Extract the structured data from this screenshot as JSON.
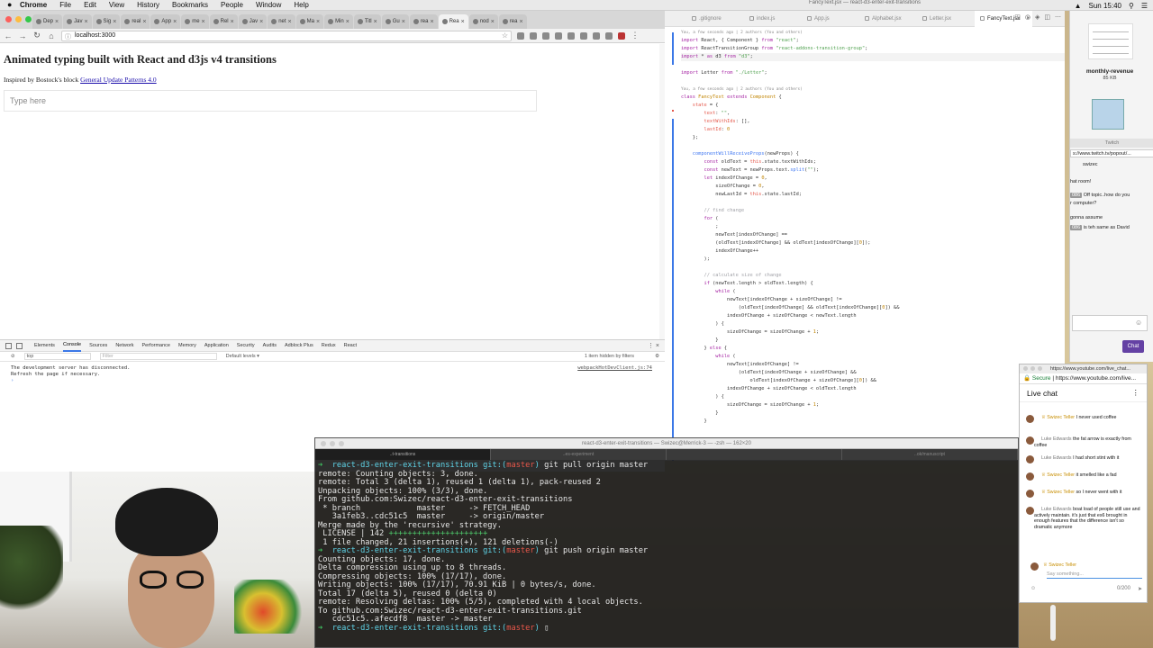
{
  "menubar": {
    "app": "Chrome",
    "menus": [
      "File",
      "Edit",
      "View",
      "History",
      "Bookmarks",
      "People",
      "Window",
      "Help"
    ],
    "clock": "Sun 15:40"
  },
  "chrome": {
    "tabs": [
      "Dep",
      "Jav",
      "Sig",
      "real",
      "App",
      "me",
      "Rel",
      "Jav",
      "net",
      "Ma",
      "Min",
      "Titl",
      "Gu",
      "rea",
      "Rea",
      "nod",
      "rea"
    ],
    "url": "localhost:3000",
    "page": {
      "title": "Animated typing built with React and d3js v4 transitions",
      "inspired_prefix": "Inspired by Bostock's block ",
      "inspired_link": "General Update Patterns 4.0",
      "input_placeholder": "Type here"
    },
    "devtools": {
      "tabs": [
        "Elements",
        "Console",
        "Sources",
        "Network",
        "Performance",
        "Memory",
        "Application",
        "Security",
        "Audits",
        "Adblock Plus",
        "Redux",
        "React"
      ],
      "context": "top",
      "filter_placeholder": "Filter",
      "levels": "Default levels ▾",
      "hidden_note": "1 item hidden by filters",
      "console_lines": [
        "The development server has disconnected.",
        "Refresh the page if necessary."
      ],
      "console_source": "webpackHotDevClient.js:74",
      "prompt": "›"
    }
  },
  "editor": {
    "window_title": "FancyText.jsx — react-d3-enter-exit-transitions",
    "tabs": [
      ".gitignore",
      "index.js",
      "App.js",
      "Alphabet.jsx",
      "Letter.jsx",
      "FancyText.jsx"
    ],
    "blame1": "You, a few seconds ago | 2 authors (You and others)",
    "blame2": "You, a few seconds ago | 2 authors (You and others)"
  },
  "sidebar": {
    "title": "monthly-revenue",
    "size": "85 KB",
    "twitch_label": "Twitch",
    "twitch_url": "s://www.twitch.tv/popout/...",
    "user": "swizec",
    "msg1": "hat room!",
    "msg2_badge": "086",
    "msg2": " Off topic..how do you",
    "msg2b": "r computer?",
    "msg3": "gonna assume",
    "msg4_badge": "086",
    "msg4": " is teh same as David",
    "chat_button": "Chat"
  },
  "terminal": {
    "title": "react-d3-enter-exit-transitions — Swizec@Merrick-3 — -zsh — 162×20",
    "tabs": [
      "..t-transitions",
      "..es-experiment",
      "",
      "..ok/manuscript"
    ]
  },
  "ytchat": {
    "window_url": "https://www.youtube.com/live_chat...",
    "secure": "Secure",
    "url": "https://www.youtube.com/live...",
    "header": "Live chat",
    "messages": [
      {
        "name": "Swizec Teller",
        "text": "I never used coffee",
        "own": true
      },
      {
        "name": "Luke Edwards",
        "text": "the fat arrow is exactly from coffee",
        "own": false
      },
      {
        "name": "Luke Edwards",
        "text": "I had short stint with it",
        "own": false
      },
      {
        "name": "Swizec Teller",
        "text": "it smelled like a fad",
        "own": true
      },
      {
        "name": "Swizec Teller",
        "text": "so I never went with it",
        "own": true
      },
      {
        "name": "Luke Edwards",
        "text": "boat load of people still use and actively maintain. it's just that es6 brought in enough features that the difference isn't so dramatic anymore",
        "own": false
      }
    ],
    "me": "Swizec Teller",
    "input_placeholder": "Say something...",
    "counter": "0/200"
  }
}
